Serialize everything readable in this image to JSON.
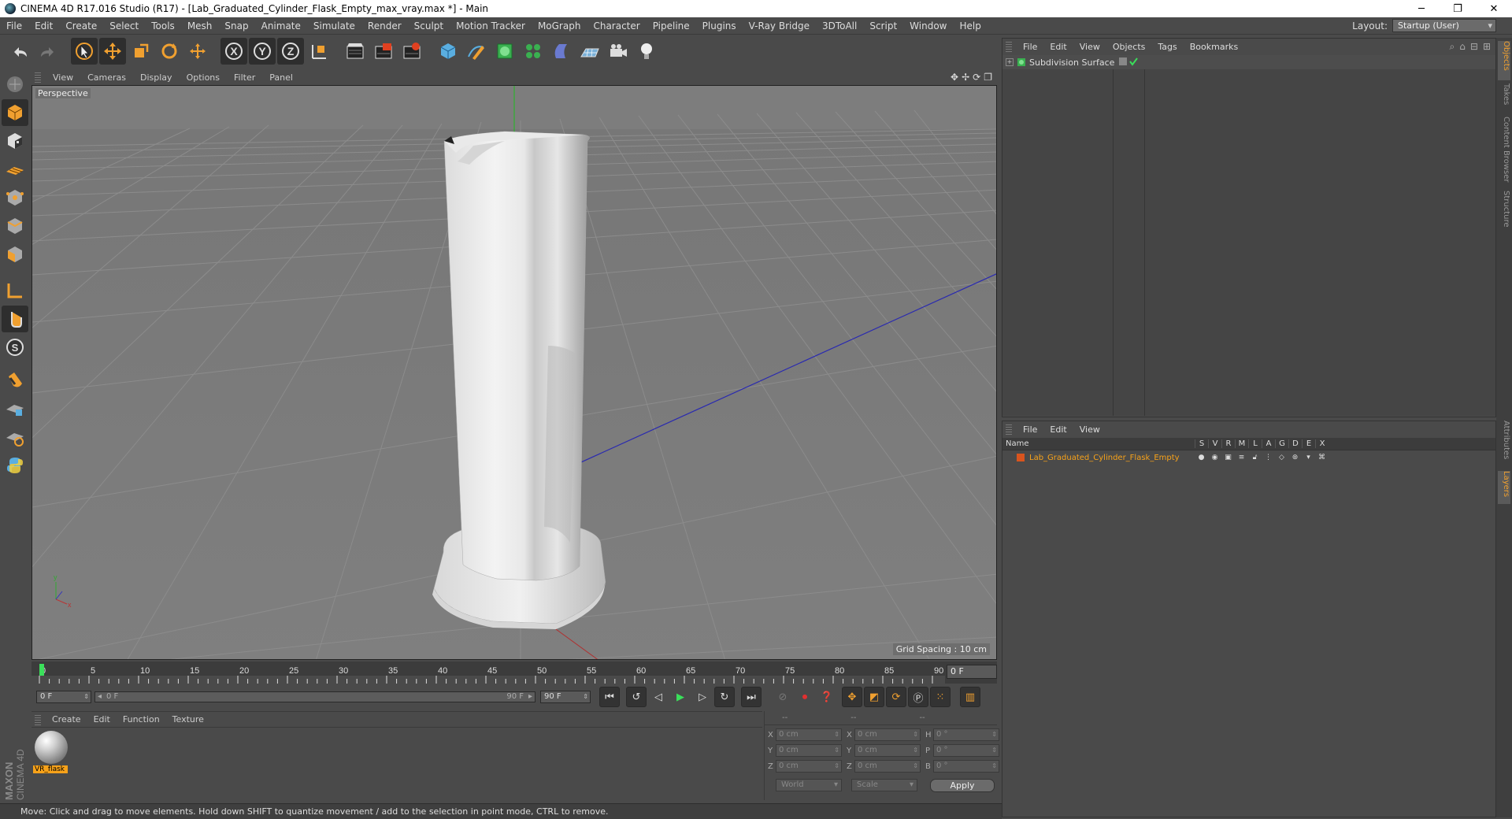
{
  "window": {
    "title": "CINEMA 4D R17.016 Studio (R17) - [Lab_Graduated_Cylinder_Flask_Empty_max_vray.max *] - Main",
    "minimize": "─",
    "restore": "❐",
    "close": "✕"
  },
  "menu": {
    "items": [
      "File",
      "Edit",
      "Create",
      "Select",
      "Tools",
      "Mesh",
      "Snap",
      "Animate",
      "Simulate",
      "Render",
      "Sculpt",
      "Motion Tracker",
      "MoGraph",
      "Character",
      "Pipeline",
      "Plugins",
      "V-Ray Bridge",
      "3DToAll",
      "Script",
      "Window",
      "Help"
    ],
    "layout_label": "Layout:",
    "layout_value": "Startup (User)"
  },
  "toolbar": {
    "x_label": "X",
    "y_label": "Y",
    "z_label": "Z"
  },
  "viewport": {
    "menu": [
      "View",
      "Cameras",
      "Display",
      "Options",
      "Filter",
      "Panel"
    ],
    "label": "Perspective",
    "grid_spacing": "Grid Spacing : 10 cm",
    "nav_icons": [
      "✥",
      "✢",
      "⟳",
      "❐"
    ]
  },
  "timeline": {
    "ticks": [
      "0",
      "5",
      "10",
      "15",
      "20",
      "25",
      "30",
      "35",
      "40",
      "45",
      "50",
      "55",
      "60",
      "65",
      "70",
      "75",
      "80",
      "85",
      "90"
    ],
    "current_frame": "0 F",
    "start_field": "0 F",
    "slider_start": "0 F",
    "slider_end": "90 F",
    "end_field": "90 F"
  },
  "material": {
    "menu": [
      "Create",
      "Edit",
      "Function",
      "Texture"
    ],
    "items": [
      {
        "name": "VR_flask"
      }
    ]
  },
  "coords": {
    "headers": [
      "--",
      "--",
      "--"
    ],
    "rows": [
      {
        "a": "X",
        "v1": "0 cm",
        "b": "X",
        "v2": "0 cm",
        "c": "H",
        "v3": "0 °"
      },
      {
        "a": "Y",
        "v1": "0 cm",
        "b": "Y",
        "v2": "0 cm",
        "c": "P",
        "v3": "0 °"
      },
      {
        "a": "Z",
        "v1": "0 cm",
        "b": "Z",
        "v2": "0 cm",
        "c": "B",
        "v3": "0 °"
      }
    ],
    "space": "World",
    "mode": "Scale",
    "apply": "Apply"
  },
  "status": "Move: Click and drag to move elements. Hold down SHIFT to quantize movement / add to the selection in point mode, CTRL to remove.",
  "brand": {
    "line1": "MAXON",
    "line2": "CINEMA 4D"
  },
  "objects": {
    "menu": [
      "File",
      "Edit",
      "View",
      "Objects",
      "Tags",
      "Bookmarks"
    ],
    "rows": [
      {
        "name": "Subdivision Surface"
      }
    ]
  },
  "layers": {
    "menu": [
      "File",
      "Edit",
      "View"
    ],
    "name_header": "Name",
    "col_headers": [
      "S",
      "V",
      "R",
      "M",
      "L",
      "A",
      "G",
      "D",
      "E",
      "X"
    ],
    "rows": [
      {
        "name": "Lab_Graduated_Cylinder_Flask_Empty",
        "color": "#d9541e"
      }
    ]
  },
  "side_tabs": [
    "Objects",
    "Takes",
    "Content Browser",
    "Structure",
    "Attributes",
    "Layers"
  ],
  "colors": {
    "accent": "#f7a21a",
    "selected_bg": "#2e2e2e",
    "viewport_bg": "#7c7c7c"
  }
}
